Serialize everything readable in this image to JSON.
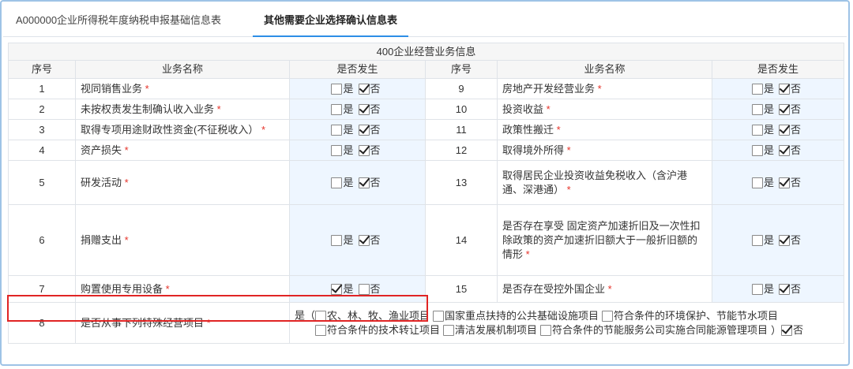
{
  "tabs": [
    {
      "label": "A000000企业所得税年度纳税申报基础信息表"
    },
    {
      "label": "其他需要企业选择确认信息表"
    }
  ],
  "section_title": "400企业经营业务信息",
  "columns": {
    "seq": "序号",
    "name": "业务名称",
    "occur": "是否发生"
  },
  "options": {
    "yes": "是",
    "no": "否"
  },
  "required_mark": "*",
  "rows": [
    {
      "left": {
        "seq": "1",
        "name": "视同销售业务",
        "yes": false,
        "no": true
      },
      "right": {
        "seq": "9",
        "name": "房地产开发经营业务",
        "yes": false,
        "no": true
      }
    },
    {
      "left": {
        "seq": "2",
        "name": "未按权责发生制确认收入业务",
        "yes": false,
        "no": true
      },
      "right": {
        "seq": "10",
        "name": "投资收益",
        "yes": false,
        "no": true
      }
    },
    {
      "left": {
        "seq": "3",
        "name": "取得专项用途财政性资金(不征税收入）",
        "yes": false,
        "no": true
      },
      "right": {
        "seq": "11",
        "name": "政策性搬迁",
        "yes": false,
        "no": true
      }
    },
    {
      "left": {
        "seq": "4",
        "name": "资产损失",
        "yes": false,
        "no": true
      },
      "right": {
        "seq": "12",
        "name": "取得境外所得",
        "yes": false,
        "no": true
      }
    },
    {
      "left": {
        "seq": "5",
        "name": "研发活动",
        "yes": false,
        "no": true
      },
      "right": {
        "seq": "13",
        "name": "取得居民企业投资收益免税收入（含沪港通、深港通）",
        "yes": false,
        "no": true
      }
    },
    {
      "left": {
        "seq": "6",
        "name": "捐赠支出",
        "yes": false,
        "no": true
      },
      "right": {
        "seq": "14",
        "name": "是否存在享受 固定资产加速折旧及一次性扣除政策的资产加速折旧额大于一般折旧额的情形",
        "yes": false,
        "no": true
      }
    },
    {
      "left": {
        "seq": "7",
        "name": "购置使用专用设备",
        "yes": true,
        "no": false
      },
      "right": {
        "seq": "15",
        "name": "是否存在受控外国企业",
        "yes": false,
        "no": true
      }
    }
  ],
  "row8": {
    "seq": "8",
    "name": "是否从事下列特殊经营项目",
    "prefix": "是（",
    "items": [
      {
        "label": "农、林、牧、渔业项目",
        "checked": false
      },
      {
        "label": "国家重点扶持的公共基础设施项目",
        "checked": false
      },
      {
        "label": "符合条件的环境保护、节能节水项目",
        "checked": false
      },
      {
        "label": "符合条件的技术转让项目",
        "checked": false
      },
      {
        "label": "清洁发展机制项目",
        "checked": false
      },
      {
        "label": "符合条件的节能服务公司实施合同能源管理项目",
        "checked": false
      }
    ],
    "suffix": "）",
    "no_label": "否",
    "no_checked": true
  }
}
